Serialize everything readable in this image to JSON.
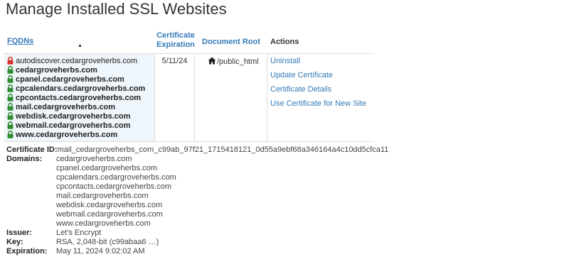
{
  "page": {
    "title": "Manage Installed SSL Websites"
  },
  "table": {
    "headers": {
      "fqdns": "FQDNs",
      "cert_expiration_line1": "Certificate",
      "cert_expiration_line2": "Expiration",
      "document_root": "Document Root",
      "actions": "Actions"
    },
    "sort_indicator": "▲",
    "row": {
      "domains": [
        {
          "name": "autodiscover.cedargroveherbs.com",
          "lock": "red"
        },
        {
          "name": "cedargroveherbs.com",
          "lock": "green"
        },
        {
          "name": "cpanel.cedargroveherbs.com",
          "lock": "green"
        },
        {
          "name": "cpcalendars.cedargroveherbs.com",
          "lock": "green"
        },
        {
          "name": "cpcontacts.cedargroveherbs.com",
          "lock": "green"
        },
        {
          "name": "mail.cedargroveherbs.com",
          "lock": "green"
        },
        {
          "name": "webdisk.cedargroveherbs.com",
          "lock": "green"
        },
        {
          "name": "webmail.cedargroveherbs.com",
          "lock": "green"
        },
        {
          "name": "www.cedargroveherbs.com",
          "lock": "green"
        }
      ],
      "expiration": "5/11/24",
      "document_root": "/public_html",
      "actions": {
        "uninstall": "Uninstall",
        "update": "Update Certificate",
        "details": "Certificate Details",
        "use_new": "Use Certificate for New Site"
      }
    }
  },
  "details": {
    "certificate_id_label": "Certificate ID:",
    "certificate_id": "mail_cedargroveherbs_com_c99ab_97f21_1715418121_0d55a9ebf68a346164a4c10dd5cfca11",
    "domains_label": "Domains:",
    "domains": [
      "cedargroveherbs.com",
      "cpanel.cedargroveherbs.com",
      "cpcalendars.cedargroveherbs.com",
      "cpcontacts.cedargroveherbs.com",
      "mail.cedargroveherbs.com",
      "webdisk.cedargroveherbs.com",
      "webmail.cedargroveherbs.com",
      "www.cedargroveherbs.com"
    ],
    "issuer_label": "Issuer:",
    "issuer": "Let's Encrypt",
    "key_label": "Key:",
    "key": "RSA, 2,048-bit (c99abaa6 …)",
    "expiration_label": "Expiration:",
    "expiration": "May 11, 2024 9:02:02 AM"
  },
  "colors": {
    "link": "#337ab7",
    "lock_green": "#2e8b2e",
    "lock_red": "#d9302c",
    "fqdn_bg": "#eef5fb"
  },
  "icons": {
    "lock": "padlock-icon",
    "home": "home-icon"
  }
}
